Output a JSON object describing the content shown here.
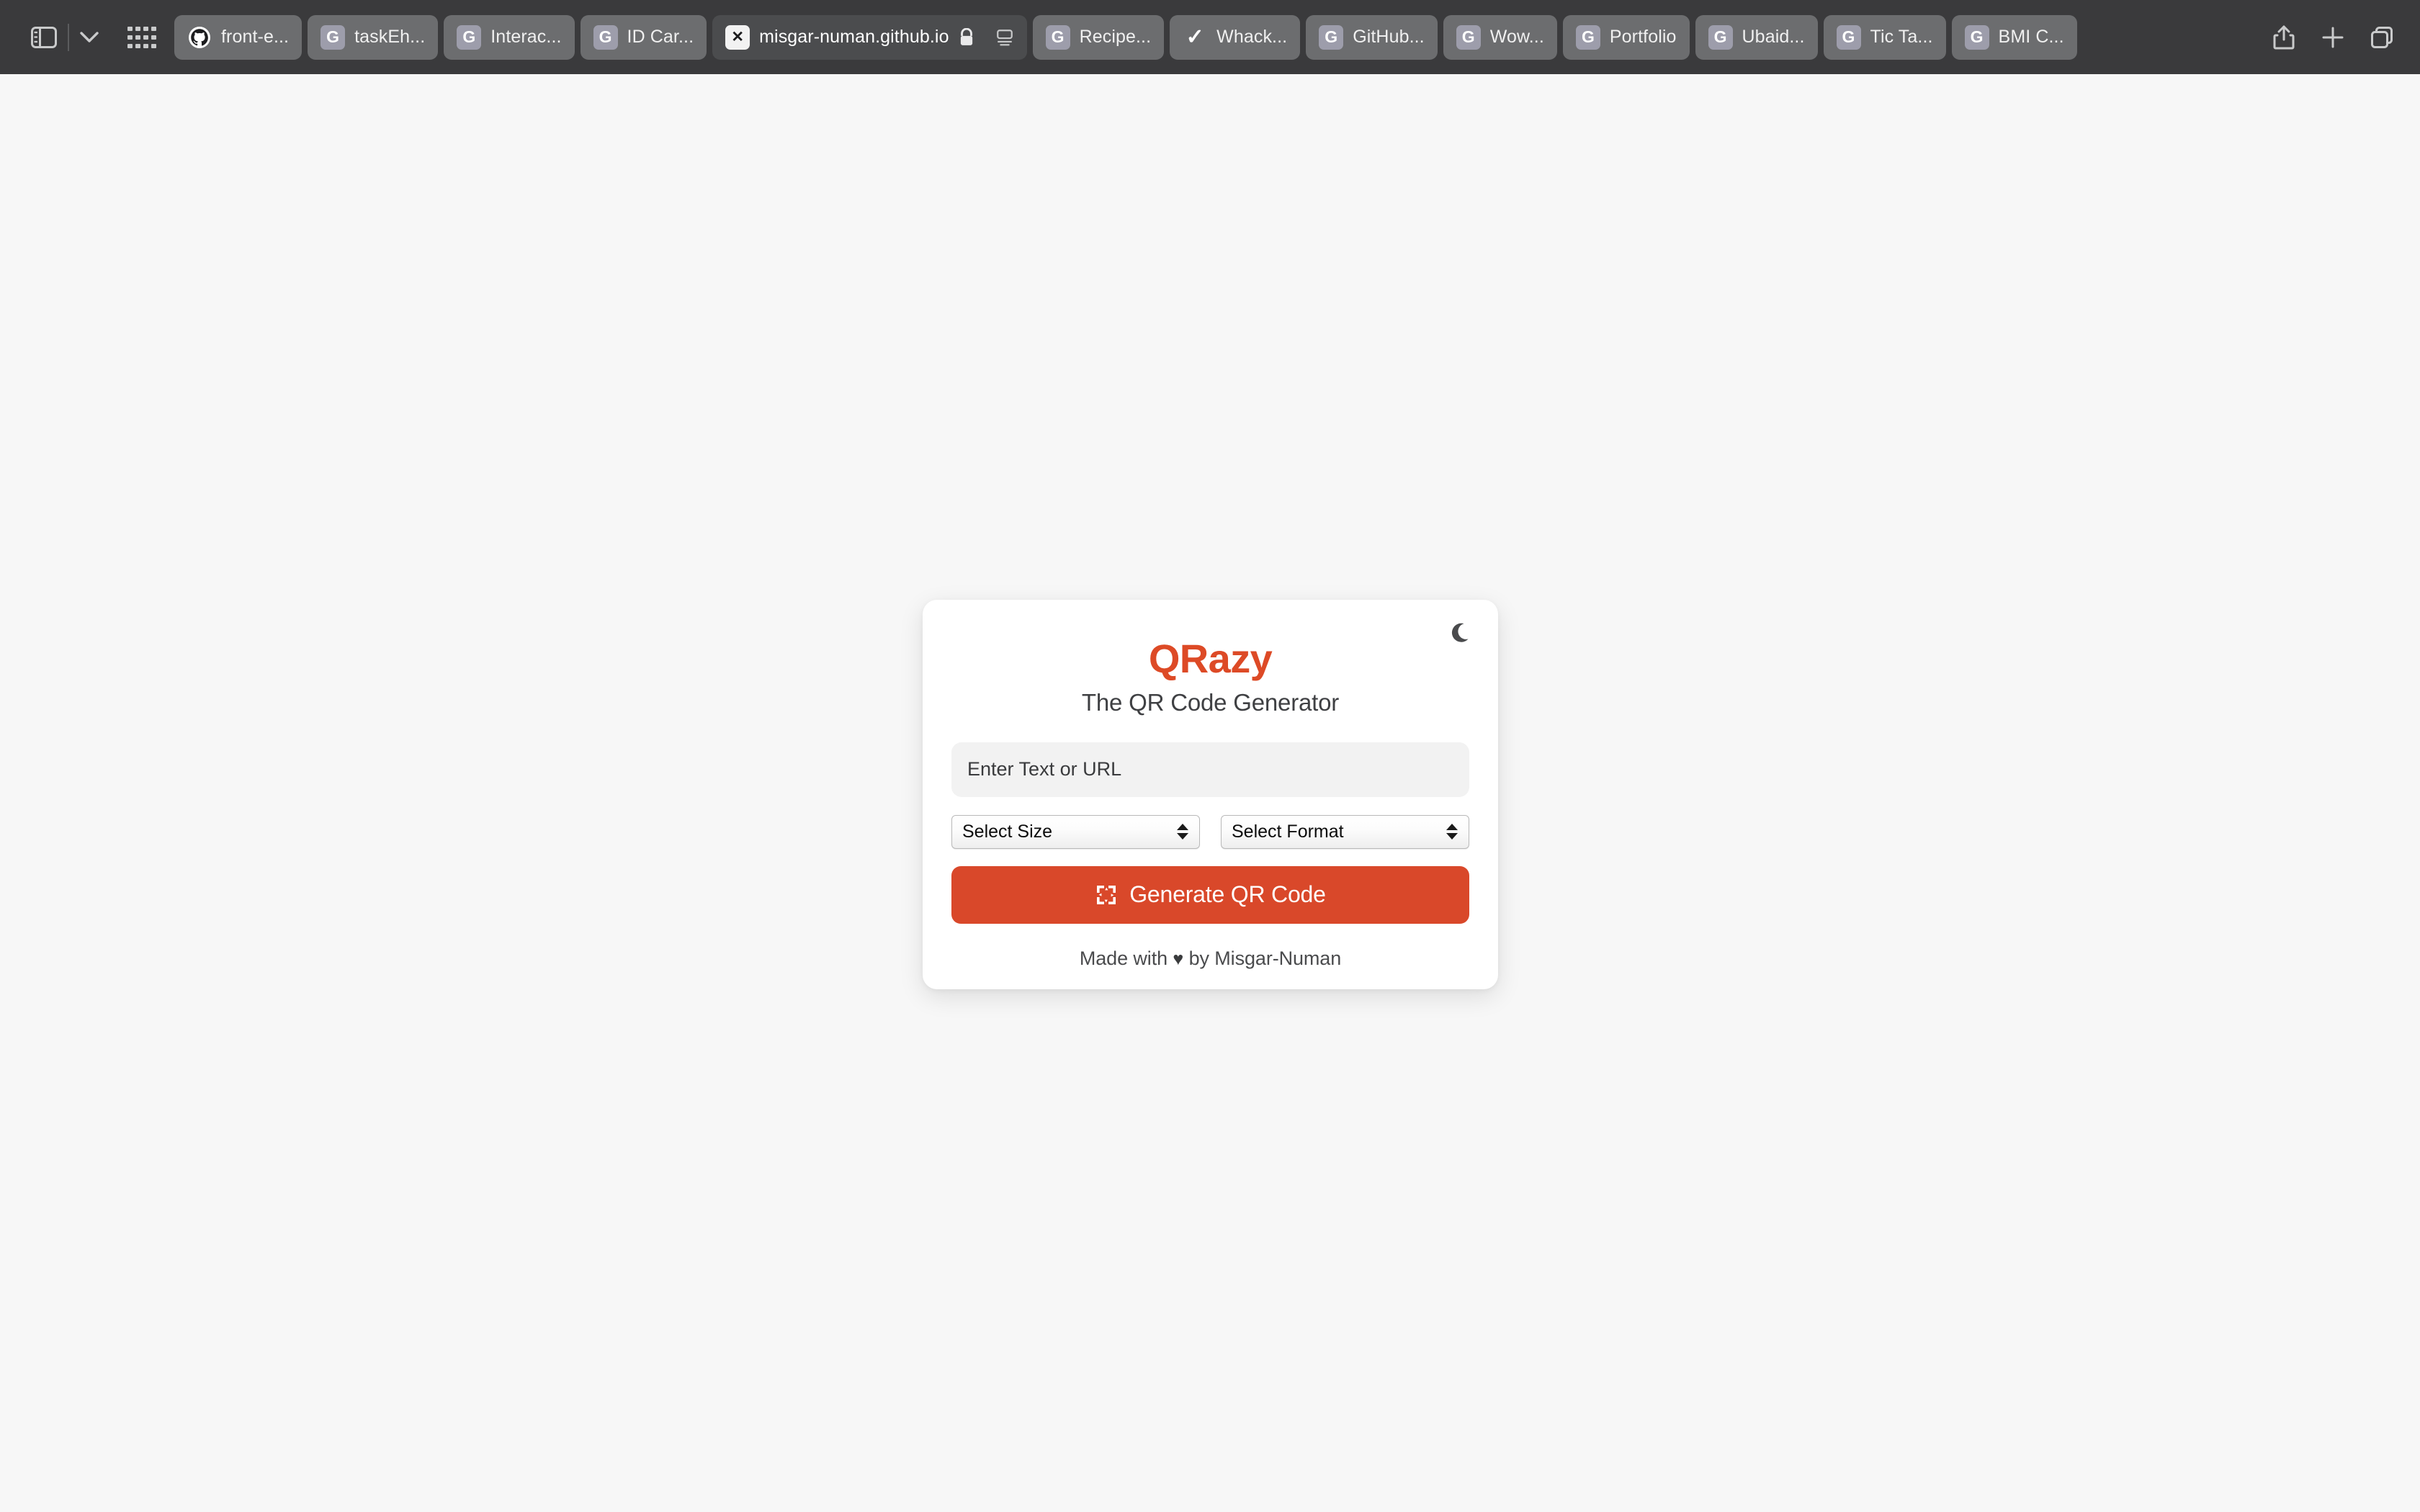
{
  "browser": {
    "toolbar_bg": "#3a3a3c",
    "controls": {
      "sidebar_toggle": "sidebar-toggle",
      "tab_group_chevron": "chevron-down-icon",
      "tab_overview_grid": "grid-icon",
      "share": "share-icon",
      "new_tab": "plus-icon",
      "tab_groups": "copy-tabs-icon"
    },
    "tabs": [
      {
        "title": "front-e...",
        "favicon": "github-icon",
        "favicon_letter": "",
        "active": false,
        "lock": false,
        "reader": false
      },
      {
        "title": "taskEh...",
        "favicon": "letter-badge",
        "favicon_letter": "G",
        "active": false,
        "lock": false,
        "reader": false
      },
      {
        "title": "Interac...",
        "favicon": "letter-badge",
        "favicon_letter": "G",
        "active": false,
        "lock": false,
        "reader": false
      },
      {
        "title": "ID Car...",
        "favicon": "letter-badge",
        "favicon_letter": "G",
        "active": false,
        "lock": false,
        "reader": false
      },
      {
        "title": "misgar-numan.github.io",
        "favicon": "x-badge",
        "favicon_letter": "✕",
        "active": true,
        "lock": true,
        "reader": true
      },
      {
        "title": "Recipe...",
        "favicon": "letter-badge",
        "favicon_letter": "G",
        "active": false,
        "lock": false,
        "reader": false
      },
      {
        "title": "Whack...",
        "favicon": "check-badge",
        "favicon_letter": "✓",
        "active": false,
        "lock": false,
        "reader": false
      },
      {
        "title": "GitHub...",
        "favicon": "letter-badge",
        "favicon_letter": "G",
        "active": false,
        "lock": false,
        "reader": false
      },
      {
        "title": "Wow...",
        "favicon": "letter-badge",
        "favicon_letter": "G",
        "active": false,
        "lock": false,
        "reader": false
      },
      {
        "title": "Portfolio",
        "favicon": "letter-badge",
        "favicon_letter": "G",
        "active": false,
        "lock": false,
        "reader": false
      },
      {
        "title": "Ubaid...",
        "favicon": "letter-badge",
        "favicon_letter": "G",
        "active": false,
        "lock": false,
        "reader": false
      },
      {
        "title": "Tic Ta...",
        "favicon": "letter-badge",
        "favicon_letter": "G",
        "active": false,
        "lock": false,
        "reader": false
      },
      {
        "title": "BMI C...",
        "favicon": "letter-badge",
        "favicon_letter": "G",
        "active": false,
        "lock": false,
        "reader": false
      }
    ]
  },
  "app": {
    "brand": "QRazy",
    "tagline": "The QR Code Generator",
    "brand_color": "#dd4a26",
    "accent_color": "#d9482a",
    "theme_toggle_icon": "moon-icon",
    "input": {
      "value": "",
      "placeholder": "Enter Text or URL"
    },
    "size_select": {
      "selected": "Select Size",
      "options": [
        "Select Size"
      ]
    },
    "format_select": {
      "selected": "Select Format",
      "options": [
        "Select Format"
      ]
    },
    "generate_button": {
      "label": "Generate QR Code",
      "icon": "qr-rotate-icon"
    },
    "footer": {
      "prefix": "Made with",
      "heart": "♥",
      "suffix": "by Misgar-Numan"
    }
  }
}
